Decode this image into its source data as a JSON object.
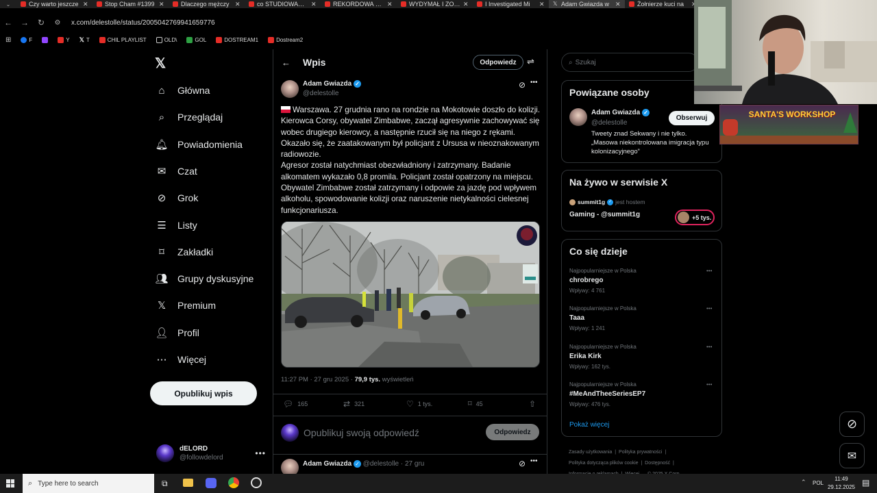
{
  "browser": {
    "tabs": [
      {
        "title": "Czy warto jeszcze"
      },
      {
        "title": "Stop Cham #1399"
      },
      {
        "title": "Dlaczego mężczy"
      },
      {
        "title": "co STUDIOWAĆ, a"
      },
      {
        "title": "REKORDOWA LIC"
      },
      {
        "title": "WYDYMAŁ I ZOST"
      },
      {
        "title": "I Investigated Mi"
      },
      {
        "title": "Adam Gwiazda w"
      },
      {
        "title": "Żołnierze kuci na"
      }
    ],
    "url": "x.com/delestolle/status/2005042769941659776",
    "bookmarks": [
      "F",
      "",
      "Y",
      "T",
      "CHIL PLAYLIST",
      "OLD\\",
      "GOL",
      "DOSTREAM1",
      "Dostream2"
    ]
  },
  "nav": {
    "items": [
      {
        "label": "Główna",
        "icon": "home-icon"
      },
      {
        "label": "Przeglądaj",
        "icon": "search-icon"
      },
      {
        "label": "Powiadomienia",
        "icon": "bell-icon"
      },
      {
        "label": "Czat",
        "icon": "mail-icon"
      },
      {
        "label": "Grok",
        "icon": "grok-icon"
      },
      {
        "label": "Listy",
        "icon": "list-icon"
      },
      {
        "label": "Zakładki",
        "icon": "bookmark-icon"
      },
      {
        "label": "Grupy dyskusyjne",
        "icon": "people-icon"
      },
      {
        "label": "Premium",
        "icon": "x-logo-icon"
      },
      {
        "label": "Profil",
        "icon": "person-icon"
      },
      {
        "label": "Więcej",
        "icon": "more-circle-icon"
      }
    ],
    "post_button": "Opublikuj wpis",
    "account": {
      "name": "dELORD",
      "handle": "@followdelord"
    }
  },
  "center": {
    "header_title": "Wpis",
    "reply_button": "Odpowiedz",
    "post": {
      "author": "Adam Gwiazda",
      "handle": "@delestolle",
      "paragraphs": [
        "Warszawa. 27 grudnia rano na rondzie na Mokotowie doszło do kolizji. Kierowca Corsy, obywatel Zimbabwe, zaczął agresywnie zachowywać się wobec drugiego kierowcy, a następnie rzucił się na niego z rękami.",
        "Okazało się, że zaatakowanym był policjant z Ursusa w nieoznakowanym radiowozie.",
        "Agresor został natychmiast obezwładniony i zatrzymany. Badanie alkomatem wykazało 0,8 promila. Policjant został opatrzony na miejscu. Obywatel Zimbabwe został zatrzymany i odpowie za jazdę pod wpływem alkoholu, spowodowanie kolizji oraz naruszenie nietykalności cielesnej funkcjonariusza."
      ],
      "meta_time": "11:27 PM · 27 gru 2025 ·",
      "meta_views_count": "79,9 tys.",
      "meta_views_label": "wyświetleń",
      "actions": {
        "replies": "165",
        "reposts": "321",
        "likes": "1 tys.",
        "bookmarks": "45"
      }
    },
    "reply_composer": {
      "placeholder": "Opublikuj swoją odpowiedź",
      "button": "Odpowiedz"
    },
    "next_post": {
      "author": "Adam Gwiazda",
      "handle_time": "@delestolle · 27 gru"
    }
  },
  "right": {
    "search_placeholder": "Szukaj",
    "related": {
      "title": "Powiązane osoby",
      "name": "Adam Gwiazda",
      "handle": "@delestolle",
      "follow": "Obserwuj",
      "bio": "Tweety znad Sekwany i nie tylko. „Masowa niekontrolowana imigracja typu kolonizacyjnego”"
    },
    "live": {
      "title": "Na żywo w serwisie X",
      "host": "summit1g",
      "host_suffix": "jest hostem",
      "name": "Gaming - @summit1g",
      "count": "+5 tys."
    },
    "trends": {
      "title": "Co się dzieje",
      "items": [
        {
          "category": "Najpopularniejsze w Polska",
          "name": "chrobrego",
          "count": "Wpływy: 4 761"
        },
        {
          "category": "Najpopularniejsze w Polska",
          "name": "Taaa",
          "count": "Wpływy: 1 241"
        },
        {
          "category": "Najpopularniejsze w Polska",
          "name": "Erika Kirk",
          "count": "Wpływy: 162 tys."
        },
        {
          "category": "Najpopularniejsze w Polska",
          "name": "#MeAndTheeSeriesEP7",
          "count": "Wpływy: 476 tys."
        }
      ],
      "show_more": "Pokaż więcej"
    },
    "footer": {
      "links": [
        "Zasady użytkowania",
        "Polityka prywatności",
        "Polityka dotycząca plików cookie",
        "Dostępność",
        "Informacje o reklamach",
        "Więcej ...",
        "© 2025 X Corp."
      ]
    }
  },
  "overlay": {
    "banner_text": "SANTA'S WORKSHOP"
  },
  "taskbar": {
    "search_placeholder": "Type here to search",
    "lang": "POL",
    "time": "11:49",
    "date": "29.12.2025"
  },
  "colors": {
    "accent": "#1d9bf0",
    "bg": "#000000",
    "border": "#2f3336",
    "muted": "#71767b"
  }
}
